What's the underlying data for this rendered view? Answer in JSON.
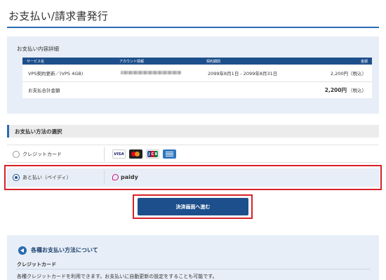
{
  "page": {
    "title": "お支払い/請求書発行"
  },
  "details": {
    "heading": "お支払い内容詳細",
    "columns": [
      "サービス名",
      "アカウント情報",
      "契約期間",
      "金額"
    ],
    "row": {
      "service": "VPS契約更新／(VPS 4GB)",
      "account": "",
      "period": "2099年8月1日 - 2099年8月31日",
      "amount": "2,200円（税込）"
    },
    "total": {
      "label": "お支払合計金額",
      "amount": "2,200円",
      "tax": "（税込）"
    }
  },
  "method": {
    "heading": "お支払い方法の選択",
    "options": [
      {
        "label": "クレジットカード",
        "selected": false
      },
      {
        "label": "あと払い（ペイディ）",
        "selected": true
      }
    ],
    "card_brands": [
      "VISA",
      "Mastercard",
      "JCB",
      "AMEX"
    ],
    "paidy_logo_text": "paidy"
  },
  "submit": {
    "label": "決済画面へ進む"
  },
  "info": {
    "title": "各種お支払い方法について",
    "subheading": "クレジットカード",
    "text": "各種クレジットカードを利用できます。お支払いに自動更新の設定をすることも可能です。"
  },
  "colors": {
    "accent": "#1d4f8c",
    "highlight": "#d7222a",
    "panel": "#e7eef7",
    "paidy": "#d1167a"
  }
}
